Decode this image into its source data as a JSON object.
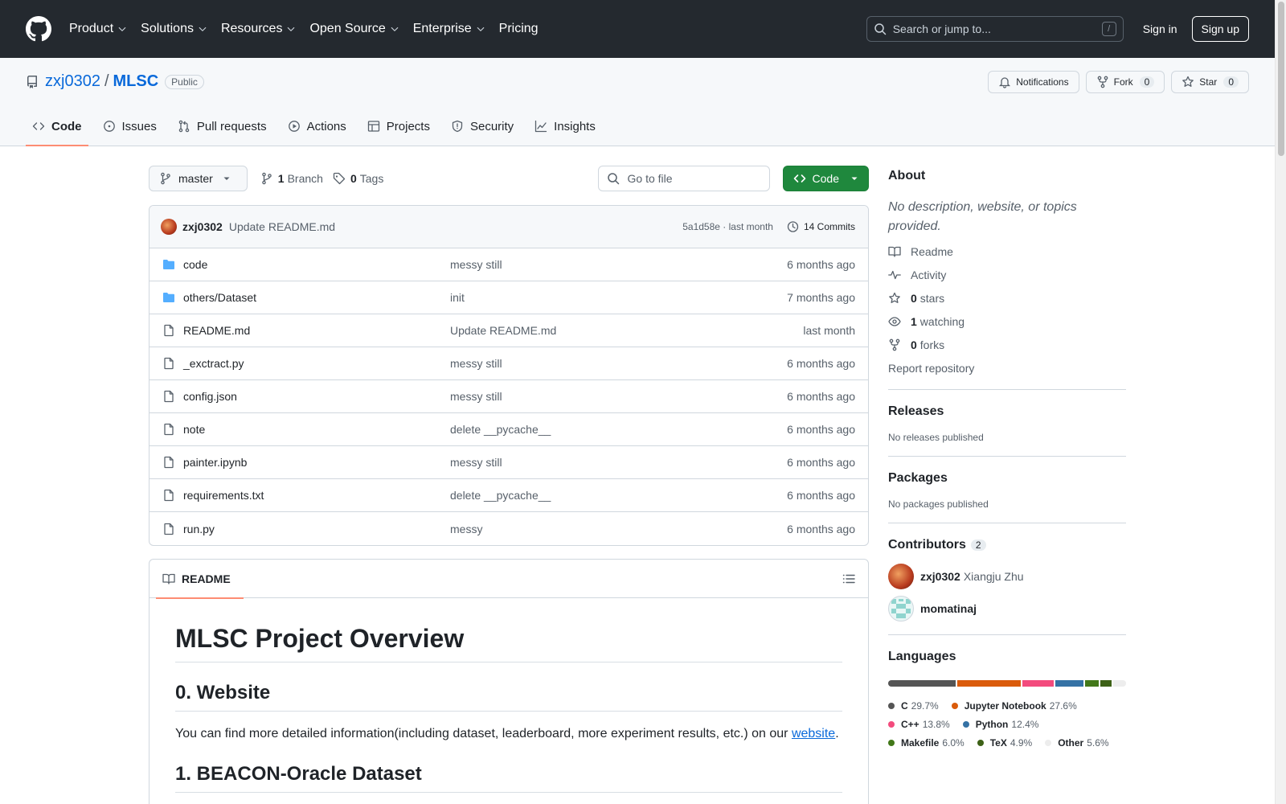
{
  "header": {
    "nav": [
      "Product",
      "Solutions",
      "Resources",
      "Open Source",
      "Enterprise",
      "Pricing"
    ],
    "nav_has_chevron": [
      true,
      true,
      true,
      true,
      true,
      false
    ],
    "search_placeholder": "Search or jump to...",
    "search_shortcut": "/",
    "sign_in": "Sign in",
    "sign_up": "Sign up"
  },
  "repo": {
    "owner": "zxj0302",
    "separator": "/",
    "name": "MLSC",
    "visibility": "Public",
    "notifications_label": "Notifications",
    "fork_label": "Fork",
    "fork_count": "0",
    "star_label": "Star",
    "star_count": "0",
    "tabs": [
      {
        "label": "Code",
        "icon": "code-icon",
        "active": true
      },
      {
        "label": "Issues",
        "icon": "issue-icon",
        "active": false
      },
      {
        "label": "Pull requests",
        "icon": "pull-request-icon",
        "active": false
      },
      {
        "label": "Actions",
        "icon": "play-icon",
        "active": false
      },
      {
        "label": "Projects",
        "icon": "table-icon",
        "active": false
      },
      {
        "label": "Security",
        "icon": "shield-icon",
        "active": false
      },
      {
        "label": "Insights",
        "icon": "graph-icon",
        "active": false
      }
    ]
  },
  "toolbar": {
    "branch": "master",
    "branch_count": "1",
    "branch_label": "Branch",
    "tag_count": "0",
    "tag_label": "Tags",
    "goto_placeholder": "Go to file",
    "code_label": "Code"
  },
  "latest_commit": {
    "author": "zxj0302",
    "message": "Update README.md",
    "meta": "5a1d58e · last month",
    "commits": "14 Commits"
  },
  "files": [
    {
      "type": "folder",
      "name": "code",
      "message": "messy still",
      "time": "6 months ago"
    },
    {
      "type": "folder",
      "name": "others/Dataset",
      "message": "init",
      "time": "7 months ago"
    },
    {
      "type": "file",
      "name": "README.md",
      "message": "Update README.md",
      "time": "last month"
    },
    {
      "type": "file",
      "name": "_exctract.py",
      "message": "messy still",
      "time": "6 months ago"
    },
    {
      "type": "file",
      "name": "config.json",
      "message": "messy still",
      "time": "6 months ago"
    },
    {
      "type": "file",
      "name": "note",
      "message": "delete __pycache__",
      "time": "6 months ago"
    },
    {
      "type": "file",
      "name": "painter.ipynb",
      "message": "messy still",
      "time": "6 months ago"
    },
    {
      "type": "file",
      "name": "requirements.txt",
      "message": "delete __pycache__",
      "time": "6 months ago"
    },
    {
      "type": "file",
      "name": "run.py",
      "message": "messy",
      "time": "6 months ago"
    }
  ],
  "readme": {
    "tab_label": "README",
    "h1": "MLSC Project Overview",
    "h2_website": "0. Website",
    "p_before_link": "You can find more detailed information(including dataset, leaderboard, more experiment results, etc.) on our ",
    "link_text": "website",
    "p_after_link": ".",
    "h2_dataset": "1. BEACON-Oracle Dataset"
  },
  "about": {
    "title": "About",
    "description": "No description, website, or topics provided.",
    "links": [
      {
        "icon": "book-icon",
        "count": "",
        "label": "Readme"
      },
      {
        "icon": "pulse-icon",
        "count": "",
        "label": "Activity"
      },
      {
        "icon": "star-icon",
        "count": "0",
        "label": "stars"
      },
      {
        "icon": "eye-icon",
        "count": "1",
        "label": "watching"
      },
      {
        "icon": "fork-icon",
        "count": "0",
        "label": "forks"
      }
    ],
    "report": "Report repository"
  },
  "releases": {
    "title": "Releases",
    "empty": "No releases published"
  },
  "packages": {
    "title": "Packages",
    "empty": "No packages published"
  },
  "contributors": {
    "title": "Contributors",
    "count": "2",
    "people": [
      {
        "login": "zxj0302",
        "name": "Xiangju Zhu"
      },
      {
        "login": "momatinaj",
        "name": ""
      }
    ]
  },
  "languages": {
    "title": "Languages",
    "items": [
      {
        "name": "C",
        "percent": "29.7%",
        "value": 29.7,
        "color": "#555555"
      },
      {
        "name": "Jupyter Notebook",
        "percent": "27.6%",
        "value": 27.6,
        "color": "#DA5B0B"
      },
      {
        "name": "C++",
        "percent": "13.8%",
        "value": 13.8,
        "color": "#f34b7d"
      },
      {
        "name": "Python",
        "percent": "12.4%",
        "value": 12.4,
        "color": "#3572A5"
      },
      {
        "name": "Makefile",
        "percent": "6.0%",
        "value": 6.0,
        "color": "#427819"
      },
      {
        "name": "TeX",
        "percent": "4.9%",
        "value": 4.9,
        "color": "#3D6117"
      },
      {
        "name": "Other",
        "percent": "5.6%",
        "value": 5.6,
        "color": "#ededed"
      }
    ]
  }
}
